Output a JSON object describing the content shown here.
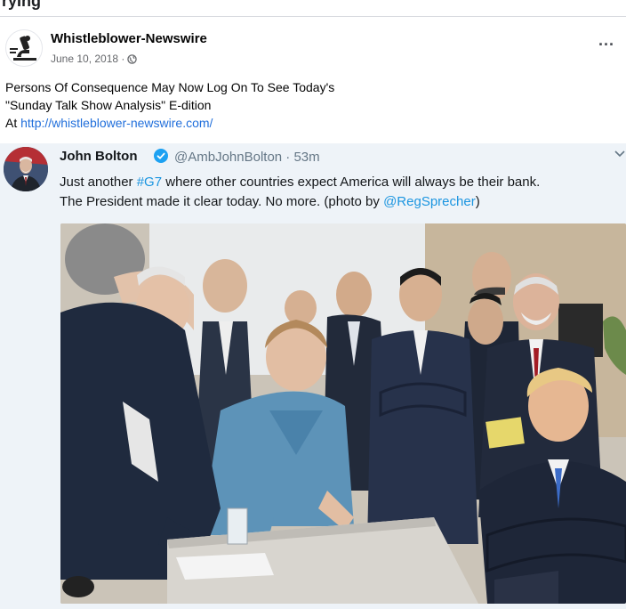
{
  "top_partial": "ryIng",
  "post": {
    "page_name": "Whistleblower-Newswire",
    "date": "June 10, 2018 ·",
    "more_label": "...",
    "text_line1": "Persons Of Consequence May Now Log On To See Today's",
    "text_line2": "\"Sunday Talk Show Analysis\" E-dition",
    "text_line3_prefix": "At ",
    "link": "http://whistleblower-newswire.com/"
  },
  "tweet": {
    "author_name": "John Bolton",
    "handle_time": "@AmbJohnBolton · 53m",
    "text_part1": "Just another ",
    "hashtag": "#G7",
    "text_part2": " where other countries expect America will always be their bank.",
    "text_part3": "The President made it clear today. No more. (photo by ",
    "mention": "@RegSprecher",
    "text_part4": ")"
  },
  "icons": {
    "page_avatar": "microscope-logo",
    "privacy": "globe-icon",
    "verified": "verified-badge-icon",
    "caret": "chevron-down-icon"
  },
  "colors": {
    "link": "#216fdb",
    "tweet_link": "#1b95e0",
    "verified": "#1da1f2",
    "tweet_bg": "#eef3f8"
  }
}
